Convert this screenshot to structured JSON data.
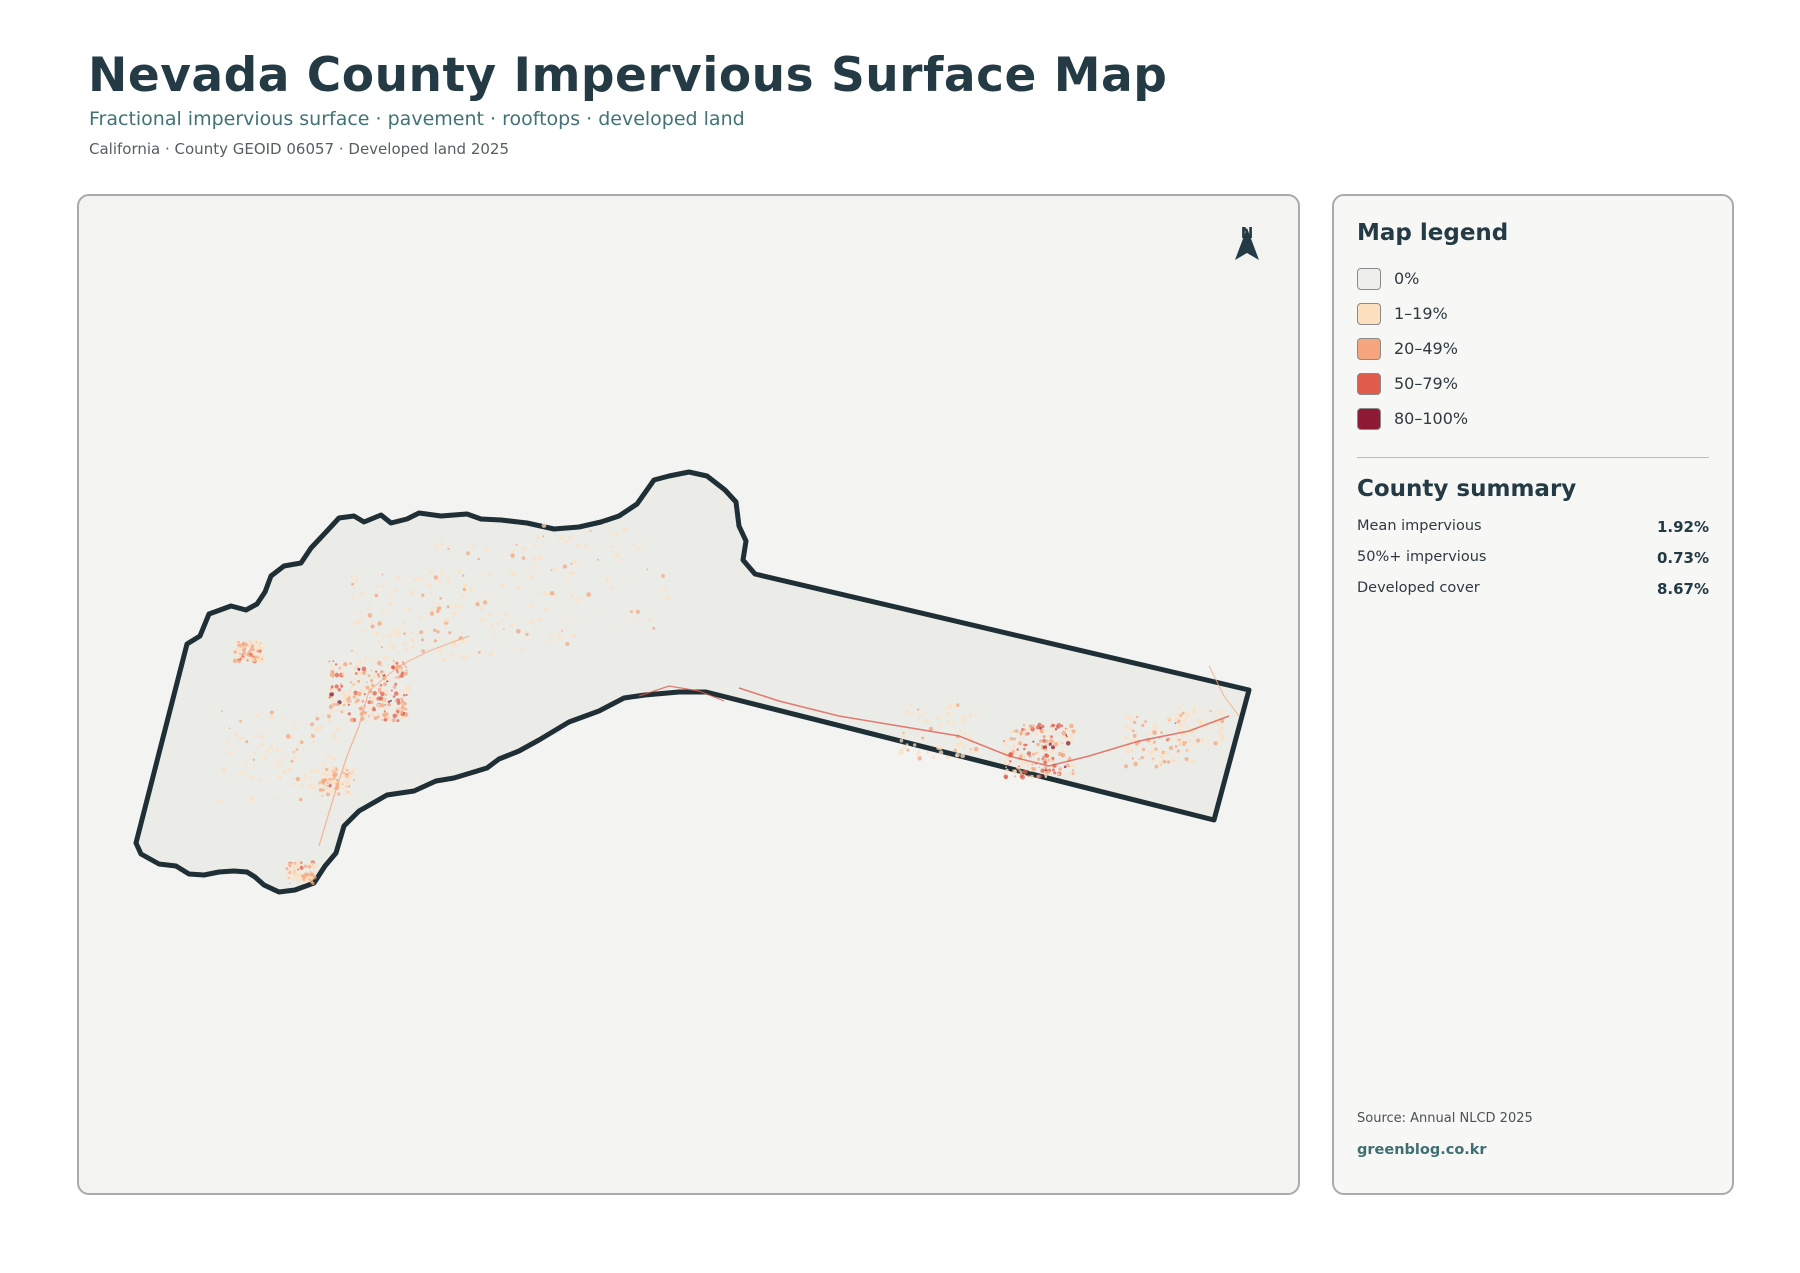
{
  "header": {
    "title": "Nevada County Impervious Surface Map",
    "subtitle": "Fractional impervious surface · pavement · rooftops · developed land",
    "meta": "California · County GEOID 06057 · Developed land 2025"
  },
  "map": {
    "north_label": "N",
    "county_fill": "#ebece8",
    "boundary_color": "#1f2f35"
  },
  "legend": {
    "heading": "Map legend",
    "items": [
      {
        "label": "0%",
        "color": "#eeeeec"
      },
      {
        "label": "1–19%",
        "color": "#fde0c0"
      },
      {
        "label": "20–49%",
        "color": "#f5a67e"
      },
      {
        "label": "50–79%",
        "color": "#e05d4d"
      },
      {
        "label": "80–100%",
        "color": "#8e1a35"
      }
    ]
  },
  "summary": {
    "heading": "County summary",
    "stats": [
      {
        "label": "Mean impervious",
        "value": "1.92%"
      },
      {
        "label": "50%+ impervious",
        "value": "0.73%"
      },
      {
        "label": "Developed cover",
        "value": "8.67%"
      }
    ]
  },
  "footer": {
    "source": "Source: Annual NLCD 2025",
    "site": "greenblog.co.kr"
  }
}
